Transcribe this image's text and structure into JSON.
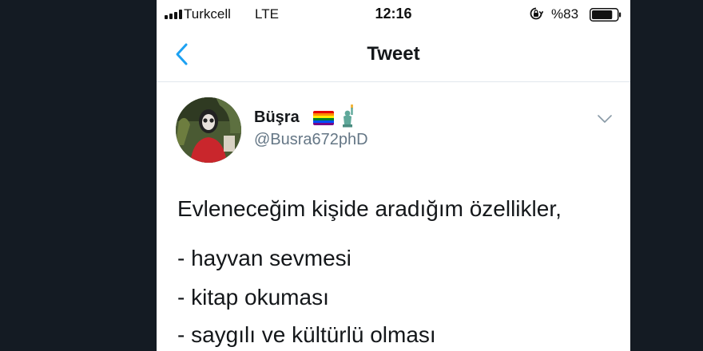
{
  "status_bar": {
    "carrier": "Turkcell",
    "network": "LTE",
    "time": "12:16",
    "battery_text": "%83",
    "battery_level": 0.83
  },
  "nav": {
    "title": "Tweet",
    "back_icon": "chevron-left-icon"
  },
  "tweet": {
    "display_name": "Büşra",
    "name_icons": [
      "rainbow-flag-icon",
      "statue-of-liberty-icon"
    ],
    "handle": "@Busra672phD",
    "lines": [
      "Evleneceğim kişide aradığım özellikler,",
      "- hayvan sevmesi",
      "- kitap okuması",
      "- saygılı ve kültürlü olması"
    ]
  },
  "colors": {
    "background": "#141b23",
    "accent": "#1da1f2",
    "text": "#14171a",
    "secondary_text": "#657786"
  }
}
